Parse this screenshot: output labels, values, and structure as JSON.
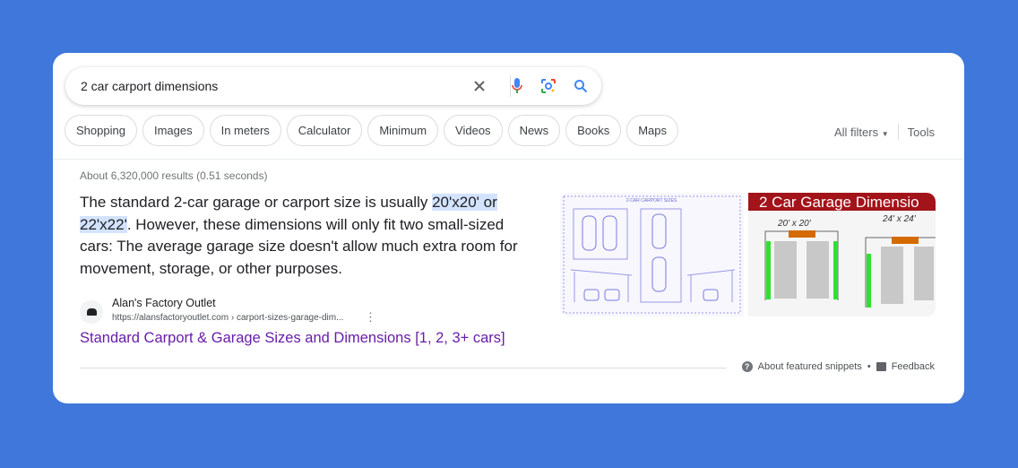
{
  "colors": {
    "background": "#3f77da",
    "link": "#681da8",
    "highlight": "#d3e3fd"
  },
  "search": {
    "query": "2 car carport dimensions",
    "icons": [
      "close-icon",
      "microphone-icon",
      "lens-icon",
      "search-icon"
    ]
  },
  "chips": [
    "Shopping",
    "Images",
    "In meters",
    "Calculator",
    "Minimum",
    "Videos",
    "News",
    "Books",
    "Maps"
  ],
  "tools": {
    "all_filters": "All filters",
    "tools": "Tools"
  },
  "stats": "About 6,320,000 results (0.51 seconds)",
  "snippet": {
    "before": "The standard 2-car garage or carport size is usually ",
    "highlight1": "20'x20' or",
    "highlight2": "22'x22'",
    "after": ". However, these dimensions will only fit two small-sized cars: The average garage size doesn't allow much extra room for movement, storage, or other purposes."
  },
  "source": {
    "name": "Alan's Factory Outlet",
    "url": "https://alansfactoryoutlet.com › carport-sizes-garage-dim...",
    "title": "Standard Carport & Garage Sizes and Dimensions [1, 2, 3+ cars]"
  },
  "images": {
    "img1_title": "2-CAR CARPORT SIZES",
    "img2_banner": "2 Car Garage Dimensio",
    "img2_label1": "20' x 20'",
    "img2_label2": "24' x 24'"
  },
  "footer": {
    "about": "About featured snippets",
    "dot": "•",
    "feedback": "Feedback"
  }
}
